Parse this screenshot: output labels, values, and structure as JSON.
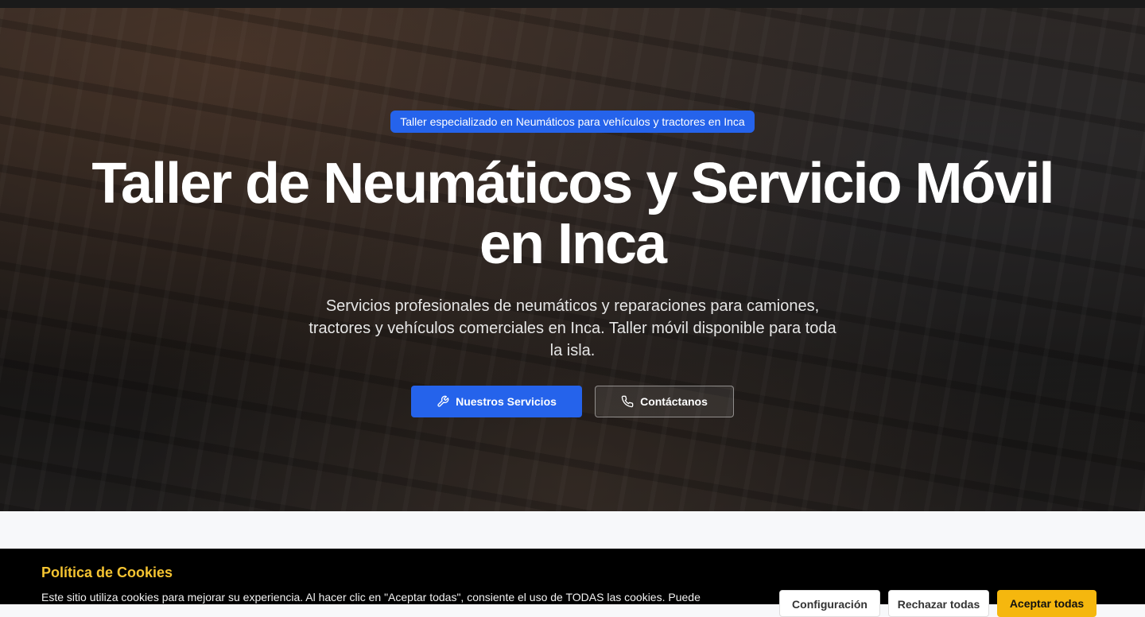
{
  "hero": {
    "badge": "Taller especializado en Neumáticos para vehículos y tractores en Inca",
    "title": "Taller de Neumáticos y Servicio Móvil en Inca",
    "subtitle": "Servicios profesionales de neumáticos y reparaciones para camiones, tractores y vehículos comerciales en Inca. Taller móvil disponible para toda la isla.",
    "primary_button": "Nuestros Servicios",
    "primary_icon": "wrench-icon",
    "secondary_button": "Contáctanos",
    "secondary_icon": "phone-icon"
  },
  "cookie_banner": {
    "title": "Política de Cookies",
    "text": "Este sitio utiliza cookies para mejorar su experiencia. Al hacer clic en \"Aceptar todas\", consiente el uso de TODAS las cookies. Puede",
    "settings_button": "Configuración",
    "reject_button": "Rechazar todas",
    "accept_button": "Aceptar todas"
  },
  "colors": {
    "accent": "#2563eb",
    "cookie_title": "#f5c431",
    "accept": "#f5b70e"
  }
}
